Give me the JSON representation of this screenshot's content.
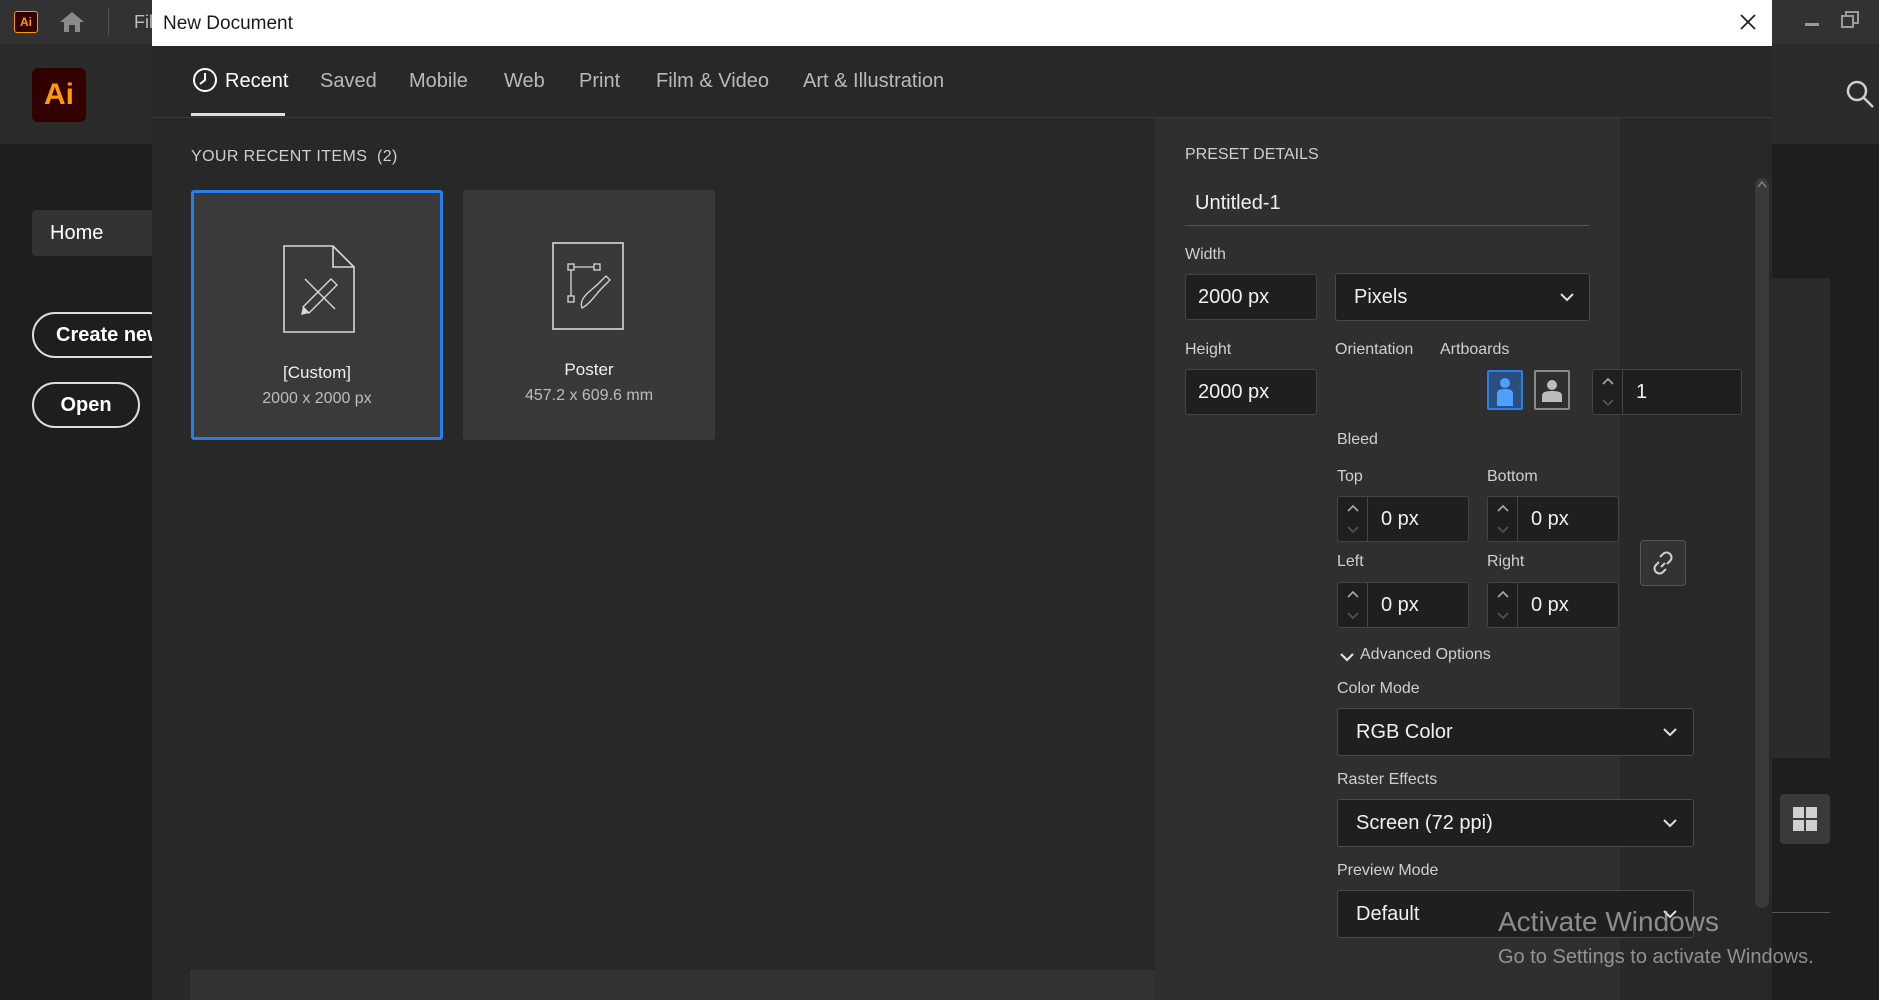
{
  "app": {
    "logo_small": "Ai",
    "logo": "Ai",
    "file_menu": "Fil",
    "home_nav": "Home",
    "create_new": "Create new",
    "open": "Open",
    "icons": [
      "home-icon",
      "search-icon",
      "minimize-icon",
      "restore-icon",
      "grid-view-icon"
    ]
  },
  "dialog": {
    "title": "New Document",
    "tabs": [
      {
        "label": "Recent",
        "active": true
      },
      {
        "label": "Saved"
      },
      {
        "label": "Mobile"
      },
      {
        "label": "Web"
      },
      {
        "label": "Print"
      },
      {
        "label": "Film & Video"
      },
      {
        "label": "Art & Illustration"
      }
    ],
    "recent": {
      "title": "YOUR RECENT ITEMS",
      "count": "(2)",
      "items": [
        {
          "name": "[Custom]",
          "size": "2000 x 2000 px",
          "selected": true,
          "icon": "custom-document-icon"
        },
        {
          "name": "Poster",
          "size": "457.2 x 609.6 mm",
          "selected": false,
          "icon": "poster-document-icon"
        }
      ]
    }
  },
  "preset": {
    "header": "PRESET DETAILS",
    "name": "Untitled-1",
    "width_label": "Width",
    "width_value": "2000 px",
    "units": "Pixels",
    "height_label": "Height",
    "height_value": "2000 px",
    "orientation_label": "Orientation",
    "artboards_label": "Artboards",
    "artboards_value": "1",
    "bleed_label": "Bleed",
    "bleed": {
      "top_label": "Top",
      "top": "0 px",
      "bottom_label": "Bottom",
      "bottom": "0 px",
      "left_label": "Left",
      "left": "0 px",
      "right_label": "Right",
      "right": "0 px"
    },
    "advanced_label": "Advanced Options",
    "color_mode_label": "Color Mode",
    "color_mode": "RGB Color",
    "raster_label": "Raster Effects",
    "raster": "Screen (72 ppi)",
    "preview_label": "Preview Mode",
    "preview": "Default"
  },
  "watermark": {
    "line1": "Activate Windows",
    "line2": "Go to Settings to activate Windows."
  },
  "colors": {
    "accent": "#2680eb",
    "dialog_bg": "#282828",
    "panel_bg": "#2f2f2f",
    "ai_orange": "#ff9a00"
  }
}
